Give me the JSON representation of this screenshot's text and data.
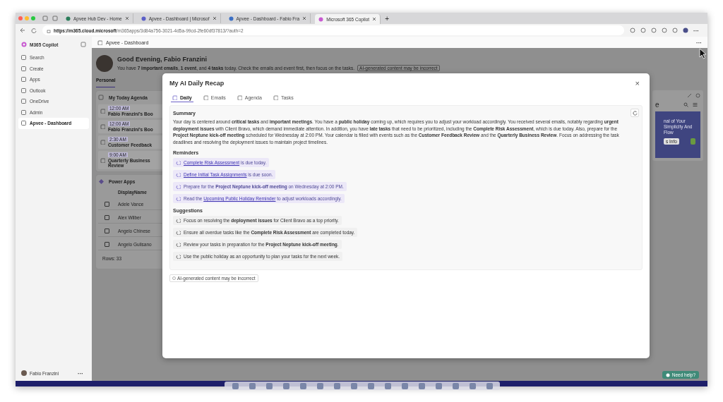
{
  "browser": {
    "tabs": [
      {
        "title": "Apvee Hub Dev - Home",
        "selected": false
      },
      {
        "title": "Apvee - Dashboard | Microsof",
        "selected": false
      },
      {
        "title": "Apvee - Dashboard - Fabio Fra",
        "selected": false
      },
      {
        "title": "Microsoft 365 Copilot",
        "selected": true
      }
    ],
    "new_tab": "+",
    "url_host": "https://m365.cloud.microsoft",
    "url_path": "/m365apps/3d84a756-3021-4d5a-99cd-2fe60df37813/?auth=2",
    "menu": "···"
  },
  "sidebar": {
    "title": "M365 Copilot",
    "items": [
      {
        "label": "Search",
        "selected": false
      },
      {
        "label": "Create",
        "selected": false
      },
      {
        "label": "Apps",
        "selected": false
      },
      {
        "label": "Outlook",
        "selected": false
      },
      {
        "label": "OneDrive",
        "selected": false
      },
      {
        "label": "Admin",
        "selected": false
      },
      {
        "label": "Apvee - Dashboard",
        "selected": true
      }
    ],
    "user": "Fabio Franzini",
    "more": "···"
  },
  "app_header": {
    "title": "Apvee - Dashboard",
    "more": "···"
  },
  "dashboard": {
    "greeting": "Good Evening, Fabio Franzini",
    "summary": "You have **7 important emails**, **1 event**, and **4 tasks** today. Check the emails and event first, then focus on the tasks.",
    "ai_note": "AI-generated content may be incorrect",
    "tabs": [
      {
        "label": "Personal",
        "selected": true
      }
    ],
    "agenda": {
      "title": "My Today Agenda",
      "items": [
        {
          "time": "12:00 AM",
          "title": "Fabio Franzini's Boo"
        },
        {
          "time": "12:00 AM",
          "title": "Fabio Franzini's Boo"
        },
        {
          "time": "2:30 AM",
          "title": "Customer Feedback"
        },
        {
          "time": "9:00 AM",
          "title": "Quarterly Business Review"
        }
      ]
    },
    "power_apps": {
      "title": "Power Apps",
      "column": "DisplayName",
      "rows": [
        {
          "name": "Adele Vance",
          "checked": false
        },
        {
          "name": "Alex Wilber",
          "checked": false
        },
        {
          "name": "Angelo Chinese",
          "checked": false
        },
        {
          "name": "Angelo Gulisano",
          "checked": false
        }
      ],
      "footer": "Rows: 33"
    },
    "right_card": {
      "letter": "e",
      "lines": [
        "nal of Your",
        "Simplicity And",
        "Flow"
      ],
      "button": "s Info"
    }
  },
  "modal": {
    "title": "My AI Daily Recap",
    "close": "×",
    "tabs": [
      {
        "label": "Daily",
        "selected": true
      },
      {
        "label": "Emails",
        "selected": false
      },
      {
        "label": "Agenda",
        "selected": false
      },
      {
        "label": "Tasks",
        "selected": false
      }
    ],
    "summary_heading": "Summary",
    "summary": "Your day is centered around **critical tasks** and **important meetings**. You have a **public holiday** coming up, which requires you to adjust your workload accordingly. You received several emails, notably regarding **urgent deployment issues** with Client Bravo, which demand immediate attention. In addition, you have **late tasks** that need to be prioritized, including the **Complete Risk Assessment**, which is due today. Also, prepare for the **Project Neptune kick-off meeting** scheduled for Wednesday at 2:00 PM. Your calendar is filled with events such as the **Customer Feedback Review** and the **Quarterly Business Review**. Focus on addressing the task deadlines and resolving the deployment issues to maintain project timelines.",
    "reminders_heading": "Reminders",
    "reminders": [
      {
        "kind": "link",
        "link": "Complete Risk Assessment",
        "after": " is due today."
      },
      {
        "kind": "link",
        "link": "Define Initial Task Assignments",
        "after": " is due soon."
      },
      {
        "kind": "text",
        "text": "Prepare for the **Project Neptune kick-off meeting** on Wednesday at 2:00 PM."
      },
      {
        "kind": "link",
        "before": "Read the ",
        "link": "Upcoming Public Holiday Reminder",
        "after": " to adjust workloads accordingly."
      }
    ],
    "suggestions_heading": "Suggestions",
    "suggestions": [
      "Focus on resolving the **deployment issues** for Client Bravo as a top priority.",
      "Ensure all overdue tasks like the **Complete Risk Assessment** are completed today.",
      "Review your tasks in preparation for the **Project Neptune kick-off meeting**.",
      "Use the public holiday as an opportunity to plan your tasks for the next week."
    ],
    "ai_note": "AI-generated content may be incorrect"
  },
  "help_button": "Need help?"
}
